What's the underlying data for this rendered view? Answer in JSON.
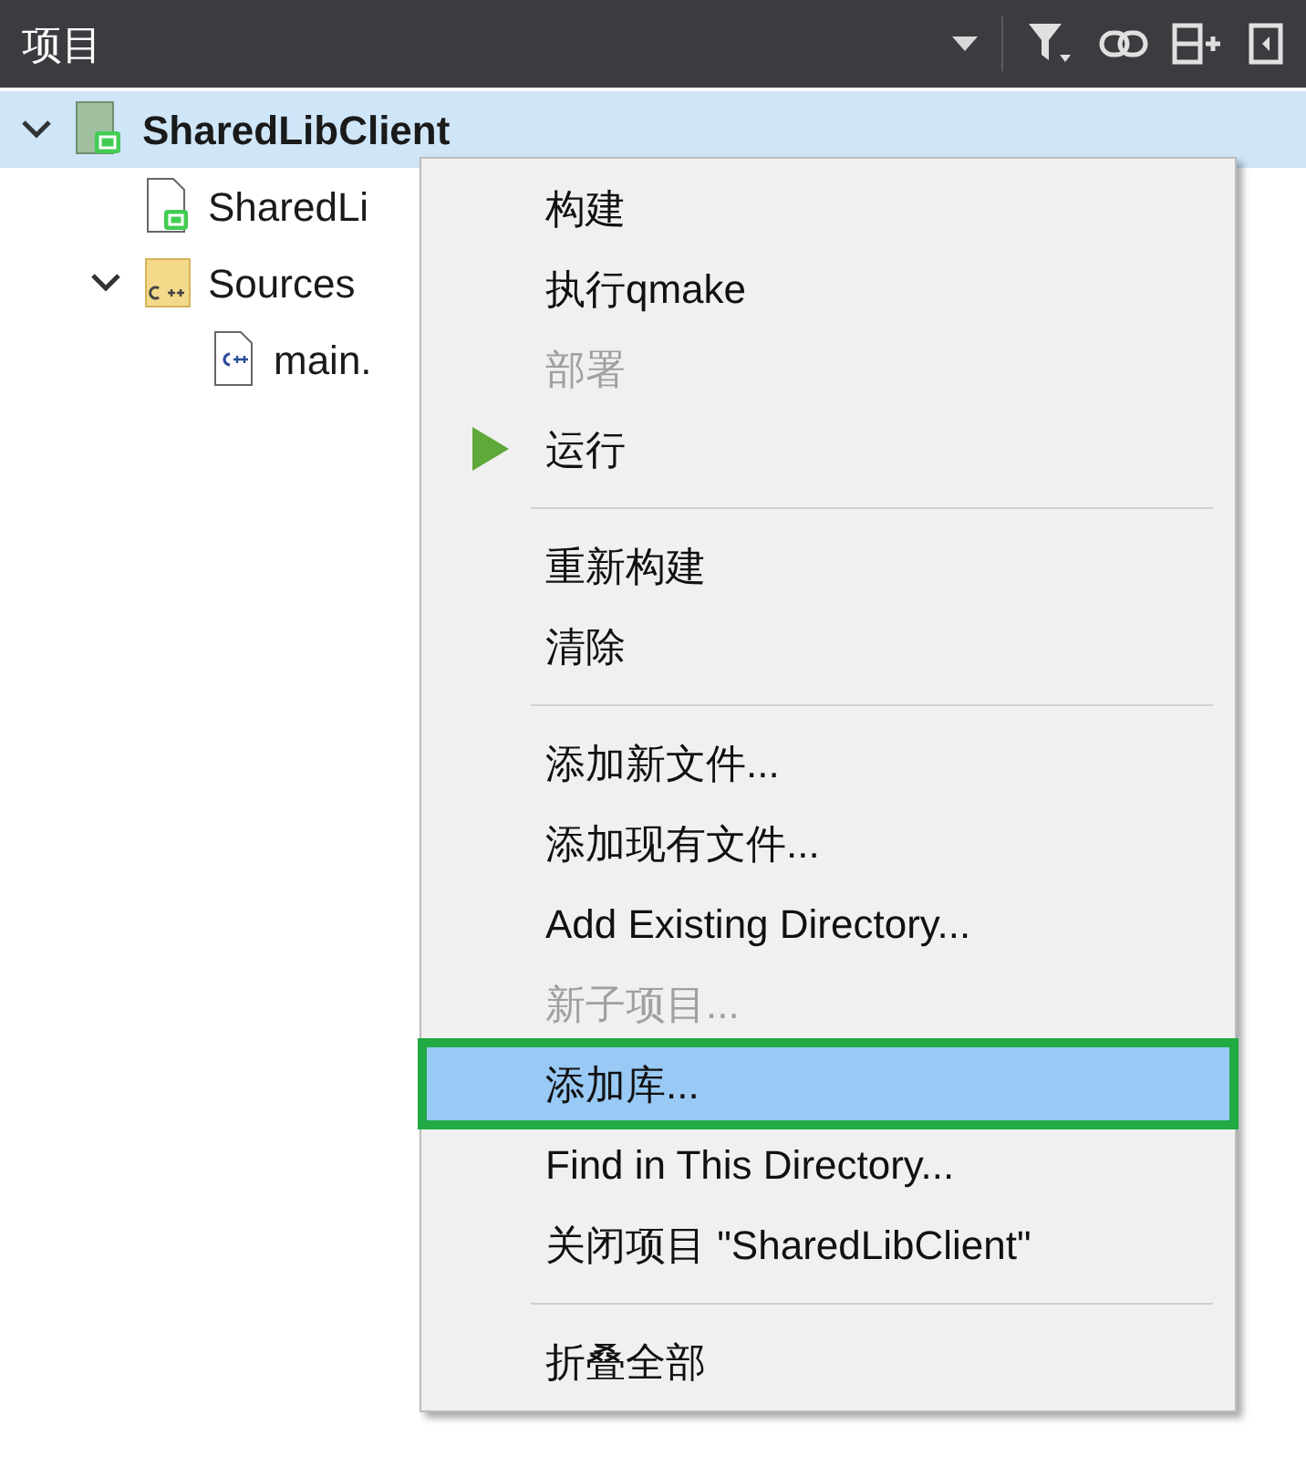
{
  "panel": {
    "title": "项目",
    "toolbar": [
      {
        "kind": "dropdown"
      },
      {
        "kind": "filter"
      },
      {
        "kind": "link"
      },
      {
        "kind": "split"
      },
      {
        "kind": "close"
      }
    ]
  },
  "tree": [
    {
      "label": "SharedLibClient",
      "kind": "project",
      "expanded": true,
      "selected": true,
      "children": [
        {
          "label": "SharedLi",
          "kind": "qtfile",
          "selected": false
        },
        {
          "label": "Sources",
          "kind": "folder",
          "expanded": true,
          "selected": false,
          "children": [
            {
              "label": "main.",
              "kind": "cppfile",
              "selected": false
            }
          ]
        }
      ]
    }
  ],
  "context_menu": {
    "items": [
      {
        "kind": "item",
        "label": "构建",
        "disabled": false,
        "selected": false
      },
      {
        "kind": "item",
        "label": "执行qmake",
        "disabled": false,
        "selected": false
      },
      {
        "kind": "item",
        "label": "部署",
        "disabled": true,
        "selected": false
      },
      {
        "kind": "run",
        "label": "运行",
        "disabled": false,
        "selected": false
      },
      {
        "kind": "separator"
      },
      {
        "kind": "item",
        "label": "重新构建",
        "disabled": false,
        "selected": false
      },
      {
        "kind": "item",
        "label": "清除",
        "disabled": false,
        "selected": false
      },
      {
        "kind": "separator"
      },
      {
        "kind": "item",
        "label": "添加新文件...",
        "disabled": false,
        "selected": false
      },
      {
        "kind": "item",
        "label": "添加现有文件...",
        "disabled": false,
        "selected": false
      },
      {
        "kind": "item",
        "label": "Add Existing Directory...",
        "disabled": false,
        "selected": false
      },
      {
        "kind": "item",
        "label": "新子项目...",
        "disabled": true,
        "selected": false
      },
      {
        "kind": "item",
        "label": "添加库...",
        "disabled": false,
        "selected": true,
        "highlighted": true
      },
      {
        "kind": "item",
        "label": "Find in This Directory...",
        "disabled": false,
        "selected": false
      },
      {
        "kind": "item",
        "label": "关闭项目 \"SharedLibClient\"",
        "disabled": false,
        "selected": false
      },
      {
        "kind": "separator"
      },
      {
        "kind": "item",
        "label": "折叠全部",
        "disabled": false,
        "selected": false
      }
    ]
  }
}
